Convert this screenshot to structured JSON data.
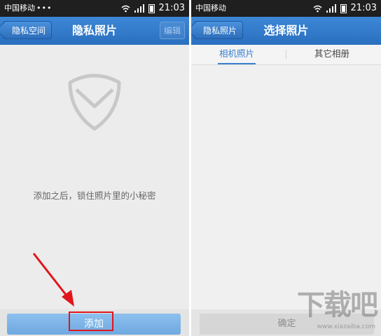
{
  "left_screen": {
    "status": {
      "carrier": "中国移动",
      "dots": "•••",
      "time": "21:03"
    },
    "header": {
      "back_label": "隐私空间",
      "title": "隐私照片",
      "edit_label": "编辑"
    },
    "empty_message": "添加之后，锁住照片里的小秘密",
    "add_button_label": "添加"
  },
  "right_screen": {
    "status": {
      "carrier": "中国移动",
      "time": "21:03"
    },
    "header": {
      "back_label": "隐私照片",
      "title": "选择照片"
    },
    "tabs": [
      {
        "label": "相机照片",
        "active": true
      },
      {
        "label": "其它相册",
        "active": false
      }
    ],
    "confirm_button_label": "确定"
  },
  "watermark": {
    "main": "下载吧",
    "sub": "www.xiazaiba.com"
  },
  "colors": {
    "header_blue": "#2f77c9",
    "annotation_red": "#e0161b",
    "tab_active": "#3a7fcf"
  }
}
